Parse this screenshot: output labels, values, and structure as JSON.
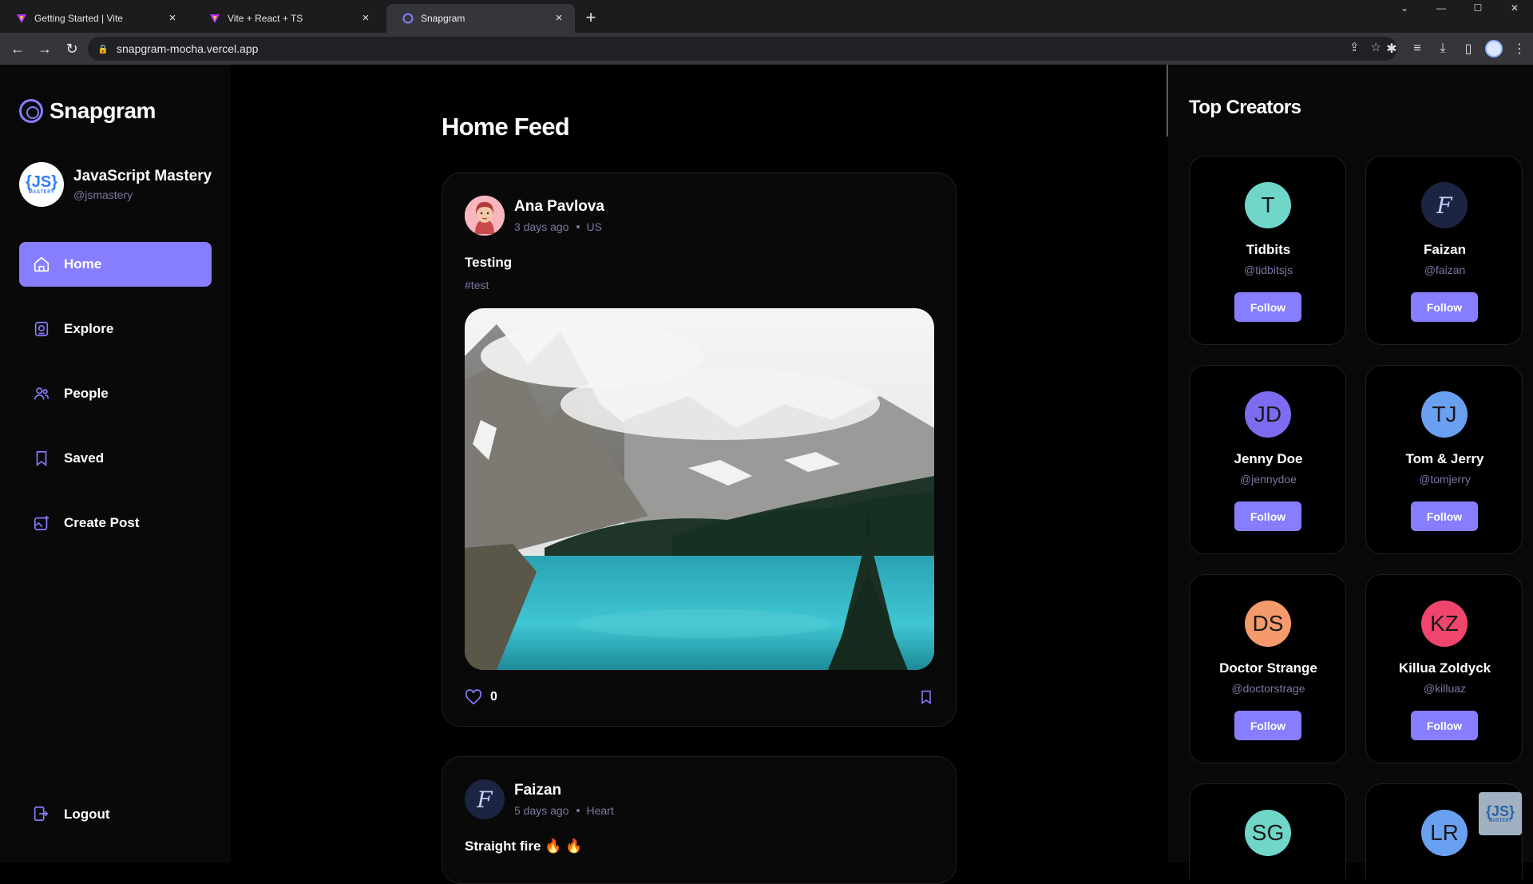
{
  "browser": {
    "tabs": [
      {
        "title": "Getting Started | Vite",
        "active": false
      },
      {
        "title": "Vite + React + TS",
        "active": false
      },
      {
        "title": "Snapgram",
        "active": true
      }
    ],
    "url": "snapgram-mocha.vercel.app"
  },
  "app": {
    "brand": "Snapgram",
    "user": {
      "name": "JavaScript Mastery",
      "handle": "@jsmastery",
      "avatar_text": "{JS}",
      "avatar_sub": "MASTERY"
    },
    "nav": [
      {
        "label": "Home",
        "icon": "home-icon",
        "active": true
      },
      {
        "label": "Explore",
        "icon": "explore-icon",
        "active": false
      },
      {
        "label": "People",
        "icon": "people-icon",
        "active": false
      },
      {
        "label": "Saved",
        "icon": "saved-icon",
        "active": false
      },
      {
        "label": "Create Post",
        "icon": "create-post-icon",
        "active": false
      }
    ],
    "logout_label": "Logout",
    "accent": "#877eff"
  },
  "feed": {
    "title": "Home Feed",
    "posts": [
      {
        "author": "Ana Pavlova",
        "time": "3 days ago",
        "location": "US",
        "caption": "Testing",
        "tags": "#test",
        "likes": "0"
      },
      {
        "author": "Faizan",
        "avatar_letter": "F",
        "time": "5 days ago",
        "location": "Heart",
        "caption": "Straight fire 🔥 🔥"
      }
    ]
  },
  "top_creators": {
    "title": "Top Creators",
    "follow_label": "Follow",
    "creators": [
      {
        "initials": "T",
        "name": "Tidbits",
        "handle": "@tidbitsjs",
        "color": "#6fd6c8"
      },
      {
        "initials": "F",
        "name": "Faizan",
        "handle": "@faizan",
        "color": "#1b2440"
      },
      {
        "initials": "JD",
        "name": "Jenny Doe",
        "handle": "@jennydoe",
        "color": "#7d6cf0"
      },
      {
        "initials": "TJ",
        "name": "Tom & Jerry",
        "handle": "@tomjerry",
        "color": "#6aa0f0"
      },
      {
        "initials": "DS",
        "name": "Doctor Strange",
        "handle": "@doctorstrage",
        "color": "#f59a6c"
      },
      {
        "initials": "KZ",
        "name": "Killua Zoldyck",
        "handle": "@killuaz",
        "color": "#f0466e"
      },
      {
        "initials": "SG",
        "color": "#6fd6c8"
      },
      {
        "initials": "LR",
        "color": "#6aa0f0"
      }
    ]
  },
  "watermark": {
    "text": "{JS}",
    "sub": "MASTERY"
  }
}
